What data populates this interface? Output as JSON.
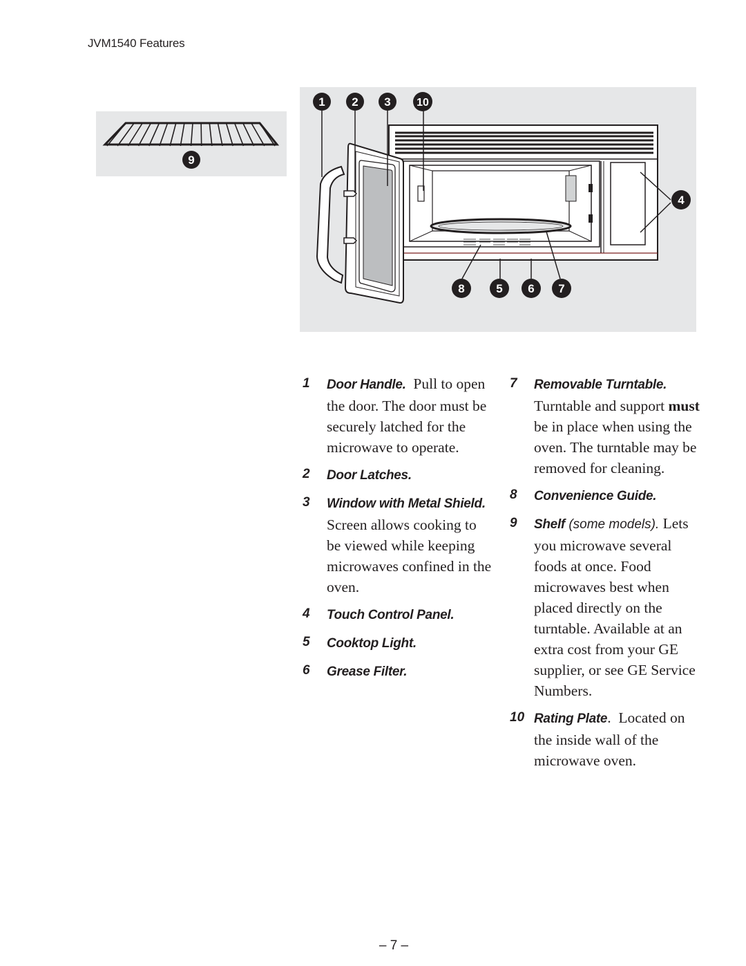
{
  "header": {
    "title": "JVM1540 Features"
  },
  "diagram": {
    "callouts": {
      "c1": "1",
      "c2": "2",
      "c3": "3",
      "c4": "4",
      "c5": "5",
      "c6": "6",
      "c7": "7",
      "c8": "8",
      "c9": "9",
      "c10": "10"
    },
    "colors": {
      "panel_background": "#e6e7e8",
      "callout_fill": "#231f20",
      "window_fill": "#bcbec0"
    }
  },
  "features": {
    "left": [
      {
        "num": "1",
        "title": "Door Handle.",
        "body": "Pull to open the door. The door must be securely latched for the microwave to operate."
      },
      {
        "num": "2",
        "title": "Door Latches."
      },
      {
        "num": "3",
        "title": "Window with Metal Shield.",
        "body": "Screen allows cooking to be viewed while keeping microwaves confined in the oven."
      },
      {
        "num": "4",
        "title": "Touch Control Panel."
      },
      {
        "num": "5",
        "title": "Cooktop Light."
      },
      {
        "num": "6",
        "title": "Grease Filter."
      }
    ],
    "right": [
      {
        "num": "7",
        "title": "Removable Turntable.",
        "body_pre": "Turntable and support",
        "body_strong": "must",
        "body_post": "be in place when using the oven. The turntable may be removed for cleaning."
      },
      {
        "num": "8",
        "title": "Convenience Guide."
      },
      {
        "num": "9",
        "title": "Shelf",
        "note": "(some models).",
        "body": "Lets you microwave several foods at once. Food microwaves best when placed directly on the turntable. Available at an extra cost from your GE supplier, or see GE Service Numbers."
      },
      {
        "num": "10",
        "title": "Rating Plate",
        "title_suffix": ".",
        "body": "Located on the inside wall of the microwave oven."
      }
    ]
  },
  "footer": {
    "page_number": "– 7 –"
  }
}
